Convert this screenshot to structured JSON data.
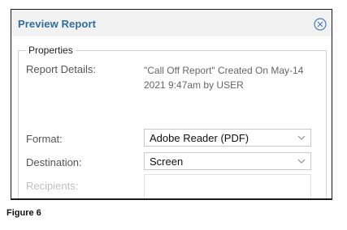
{
  "dialog": {
    "title": "Preview Report",
    "close_icon": "close-circle-icon"
  },
  "properties": {
    "legend": "Properties",
    "report_details_label": "Report Details:",
    "report_details_value": "\"Call Off Report\" Created On May-14 2021 9:47am by USER",
    "format_label": "Format:",
    "format_value": "Adobe Reader (PDF)",
    "destination_label": "Destination:",
    "destination_value": "Screen",
    "recipients_label": "Recipients:",
    "dropdown_icon": "chevron-down-icon"
  },
  "caption": "Figure 6",
  "colors": {
    "title": "#2e6da4",
    "title_bar": "#f2f2f2",
    "close_icon": "#4a7fb5",
    "disabled_label": "#c0c0c0"
  }
}
